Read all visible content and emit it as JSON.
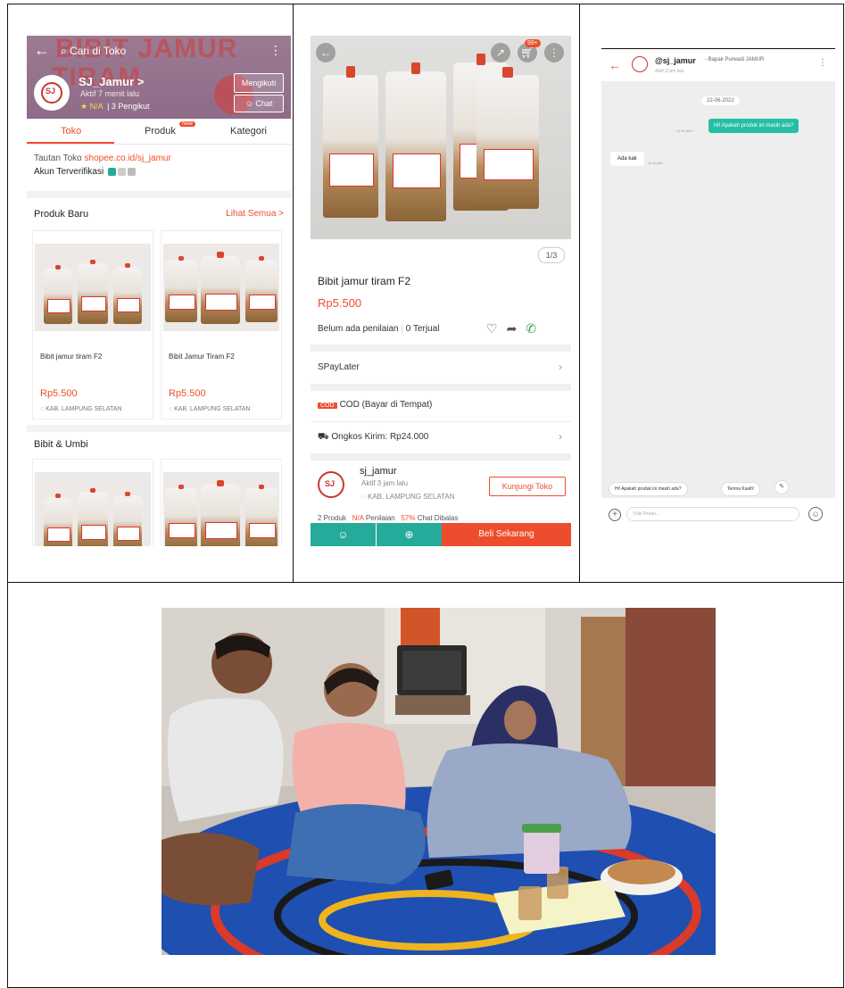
{
  "shop_page": {
    "search_placeholder": "Cari di Toko",
    "banner_line1": "BIBIT JAMUR",
    "banner_line2": "TIRAM",
    "shop_name": "SJ_Jamur >",
    "active_status": "Aktif 7 menit lalu",
    "rating": "★ N/A",
    "followers": "3 Pengikut",
    "follow_button": "Mengikuti",
    "chat_button": "☺ Chat",
    "tabs": [
      "Toko",
      "Produk",
      "Kategori"
    ],
    "new_badge": "New",
    "shop_link_label": "Tautan Toko",
    "shop_link_url": "shopee.co.id/sj_jamur",
    "verified_label": "Akun Terverifikasi",
    "section_new": "Produk Baru",
    "see_all": "Lihat Semua >",
    "products": [
      {
        "name": "Bibit jamur tiram F2",
        "price": "Rp5.500",
        "location": "KAB. LAMPUNG SELATAN"
      },
      {
        "name": "Bibit Jamur Tiram F2",
        "price": "Rp5.500",
        "location": "KAB. LAMPUNG SELATAN"
      }
    ],
    "section_seeds": "Bibit & Umbi"
  },
  "product_page": {
    "cart_count": "99+",
    "image_pager": "1/3",
    "title": "Bibit jamur tiram F2",
    "price": "Rp5.500",
    "rating_text": "Belum ada penilaian",
    "sold_text": "0 Terjual",
    "spaylater": "SPayLater",
    "cod_tag": "COD",
    "cod_text": "COD (Bayar di Tempat)",
    "shipping": "Ongkos Kirim: Rp24.000",
    "shop_name": "sj_jamur",
    "shop_active": "Aktif 3 jam lalu",
    "shop_location": "KAB. LAMPUNG SELATAN",
    "visit_button": "Kunjungi Toko",
    "stats_products": "2 Produk",
    "stats_rating_value": "N/A",
    "stats_rating_label": "Penilaian",
    "stats_chat_value": "57%",
    "stats_chat_label": "Chat Dibalas",
    "buy_button": "Beli Sekarang"
  },
  "chat_page": {
    "username": "@sj_jamur",
    "subtitle": "- Bapak Purwadi JAMUR",
    "last_seen": "Aktif 3 jam lalu",
    "date": "22-06-2022",
    "outgoing_message": "Hi! Apakah produk ini masih ada?",
    "outgoing_time": "11.06 AM ✓",
    "incoming_message": "Ada kak",
    "incoming_time": "11.30 AM",
    "quick_replies": [
      "Hi! Apakah produk ini masih ada?",
      "Terima Kasih!"
    ],
    "input_placeholder": "Tulis Pesan..."
  },
  "colors": {
    "shopee_orange": "#ee4d2d",
    "teal": "#26aa99",
    "banner": "#8e6c88"
  }
}
